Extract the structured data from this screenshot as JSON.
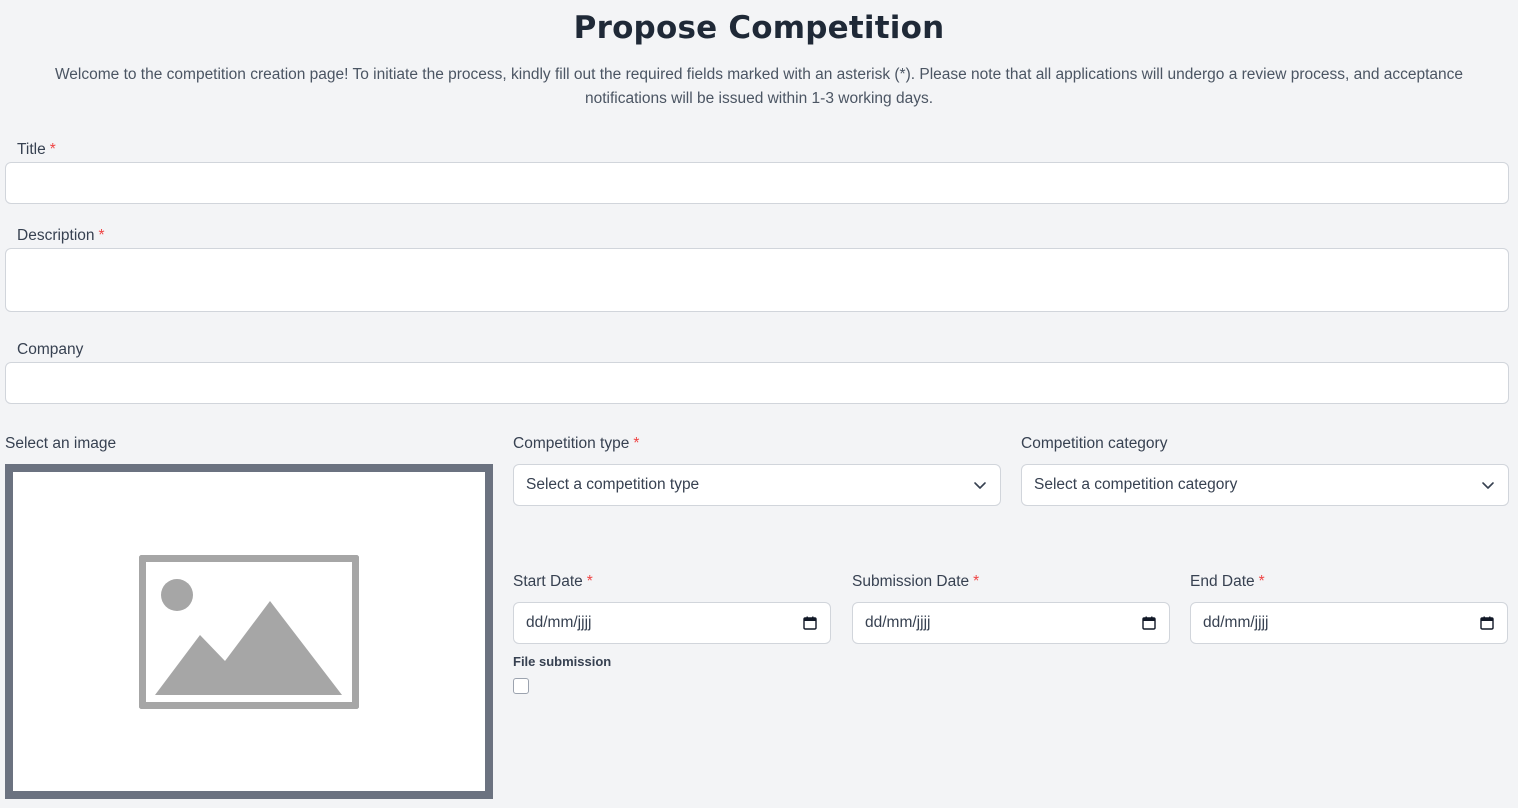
{
  "page": {
    "title": "Propose Competition",
    "intro": "Welcome to the competition creation page! To initiate the process, kindly fill out the required fields marked with an asterisk (*). Please note that all applications will undergo a review process, and acceptance notifications will be issued within 1-3 working days.",
    "required_marker": "*"
  },
  "form": {
    "title_label": "Title",
    "title_value": "",
    "description_label": "Description",
    "description_value": "",
    "company_label": "Company",
    "company_value": "",
    "image_label": "Select an image",
    "image_placeholder_icon": "image-placeholder-icon",
    "competition_type_label": "Competition type",
    "competition_type_placeholder": "Select a competition type",
    "competition_category_label": "Competition category",
    "competition_category_placeholder": "Select a competition category",
    "start_date_label": "Start Date",
    "start_date_value": "dd/mm/jjjj",
    "submission_date_label": "Submission Date",
    "submission_date_value": "dd/mm/jjjj",
    "end_date_label": "End Date",
    "end_date_value": "dd/mm/jjjj",
    "file_submission_label": "File submission",
    "file_submission_checked": false
  },
  "icons": {
    "dropdown": "chevron-down-icon",
    "date": "calendar-icon"
  },
  "colors": {
    "background": "#f3f4f6",
    "required": "#ef4444",
    "heading": "#1f2937",
    "image_border": "#6b7280"
  }
}
